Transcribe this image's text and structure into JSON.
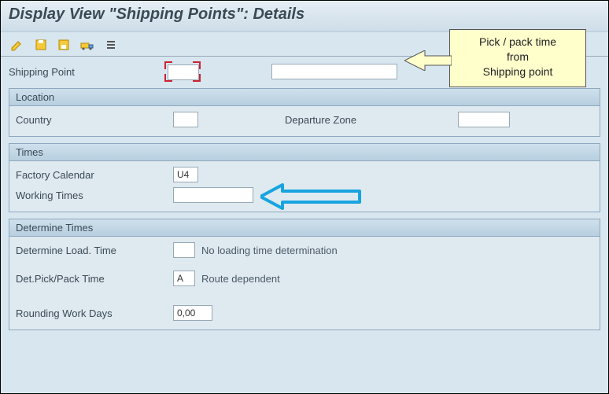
{
  "title": "Display View \"Shipping Points\": Details",
  "toolbar": {
    "icons": [
      "edit-icon",
      "save-icon",
      "save-as-icon",
      "transport-icon",
      "list-icon"
    ]
  },
  "shipping_point": {
    "label": "Shipping Point",
    "value": "",
    "desc": ""
  },
  "groups": {
    "location": {
      "title": "Location",
      "country": {
        "label": "Country",
        "value": ""
      },
      "departure_zone": {
        "label": "Departure Zone",
        "value": ""
      }
    },
    "times": {
      "title": "Times",
      "factory_calendar": {
        "label": "Factory Calendar",
        "value": "U4"
      },
      "working_times": {
        "label": "Working Times",
        "value": ""
      }
    },
    "determine": {
      "title": "Determine Times",
      "load_time": {
        "label": "Determine Load. Time",
        "code": "",
        "desc": "No loading time determination"
      },
      "pick_pack": {
        "label": "Det.Pick/Pack Time",
        "code": "A",
        "desc": "Route dependent"
      },
      "rounding": {
        "label": "Rounding Work Days",
        "value": "0,00"
      }
    }
  },
  "callout": {
    "line1": "Pick / pack time",
    "line2": "from",
    "line3": "Shipping point"
  },
  "colors": {
    "accent_blue": "#18a4e0"
  }
}
